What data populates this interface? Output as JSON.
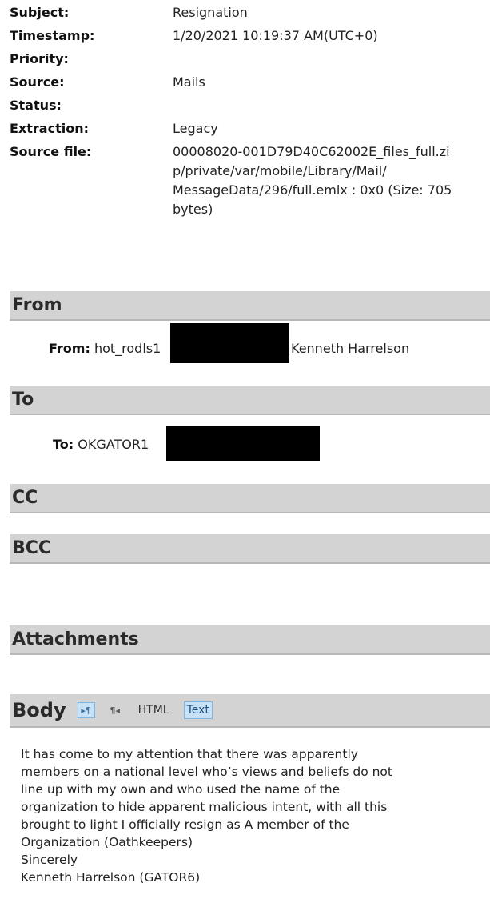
{
  "meta": {
    "subject_label": "Subject:",
    "subject_value": "Resignation",
    "timestamp_label": "Timestamp:",
    "timestamp_value": "1/20/2021 10:19:37 AM(UTC+0)",
    "priority_label": "Priority:",
    "priority_value": "",
    "source_label": "Source:",
    "source_value": "Mails",
    "status_label": "Status:",
    "status_value": "",
    "extraction_label": "Extraction:",
    "extraction_value": "Legacy",
    "source_file_label": "Source file:",
    "source_file_lines": [
      "00008020-001D79D40C62002E_files_full.zi",
      "p/private/var/mobile/Library/Mail/",
      "MessageData/296/full.emlx : 0x0 (Size: 705",
      "bytes)"
    ]
  },
  "sections": {
    "from_title": "From",
    "to_title": "To",
    "cc_title": "CC",
    "bcc_title": "BCC",
    "attachments_title": "Attachments",
    "body_title": "Body"
  },
  "from": {
    "label": "From:",
    "address_visible": "hot_rodls1",
    "name": "Kenneth Harrelson"
  },
  "to": {
    "label": "To:",
    "address_visible": "OKGATOR1"
  },
  "body_toolbar": {
    "ltr_icon": "ltr-paragraph-icon",
    "ltr_glyph": "▸¶",
    "rtl_icon": "rtl-paragraph-icon",
    "rtl_glyph": "¶◂",
    "html_label": "HTML",
    "text_label": "Text"
  },
  "body_lines": [
    "It has come to my attention that there was apparently",
    "members on a national level who’s views and beliefs do not",
    "line up with my own and who used the name of the",
    "organization to hide apparent malicious intent, with all this",
    "brought to light I officially resign as A member of the",
    "Organization (Oathkeepers)",
    "Sincerely",
    "Kenneth Harrelson (GATOR6)"
  ],
  "colors": {
    "section_bg": "#d3d3d3",
    "redaction": "#000000",
    "active_toggle_bg": "#c7e1f7"
  }
}
